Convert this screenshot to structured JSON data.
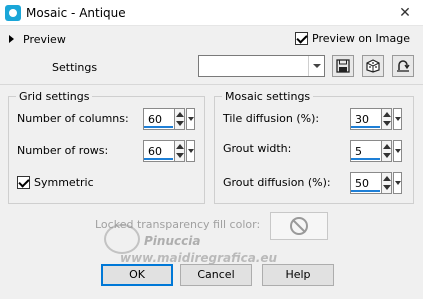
{
  "window": {
    "title": "Mosaic - Antique",
    "close_glyph": "✕"
  },
  "preview": {
    "label": "Preview",
    "on_image_label": "Preview on Image",
    "on_image_checked": true
  },
  "settings": {
    "label": "Settings",
    "value": ""
  },
  "toolbar": {
    "icons": [
      "save-icon",
      "dice-icon",
      "reset-icon"
    ]
  },
  "grid_settings": {
    "title": "Grid settings",
    "columns_label": "Number of columns:",
    "columns_value": "60",
    "rows_label": "Number of rows:",
    "rows_value": "60",
    "symmetric_label": "Symmetric",
    "symmetric_checked": true
  },
  "mosaic_settings": {
    "title": "Mosaic settings",
    "tile_diffusion_label": "Tile diffusion (%):",
    "tile_diffusion_value": "30",
    "grout_width_label": "Grout width:",
    "grout_width_value": "5",
    "grout_diffusion_label": "Grout diffusion (%):",
    "grout_diffusion_value": "50"
  },
  "locked_fill": {
    "label": "Locked transparency fill color:"
  },
  "watermark": {
    "line1": "Pinuccia",
    "line2": "www.maidiregrafica.eu"
  },
  "buttons": {
    "ok": "OK",
    "cancel": "Cancel",
    "help": "Help"
  },
  "colors": {
    "accent": "#0078d7",
    "spin_underline": "#1e7fd6",
    "app_icon": "#1aa6d8"
  }
}
